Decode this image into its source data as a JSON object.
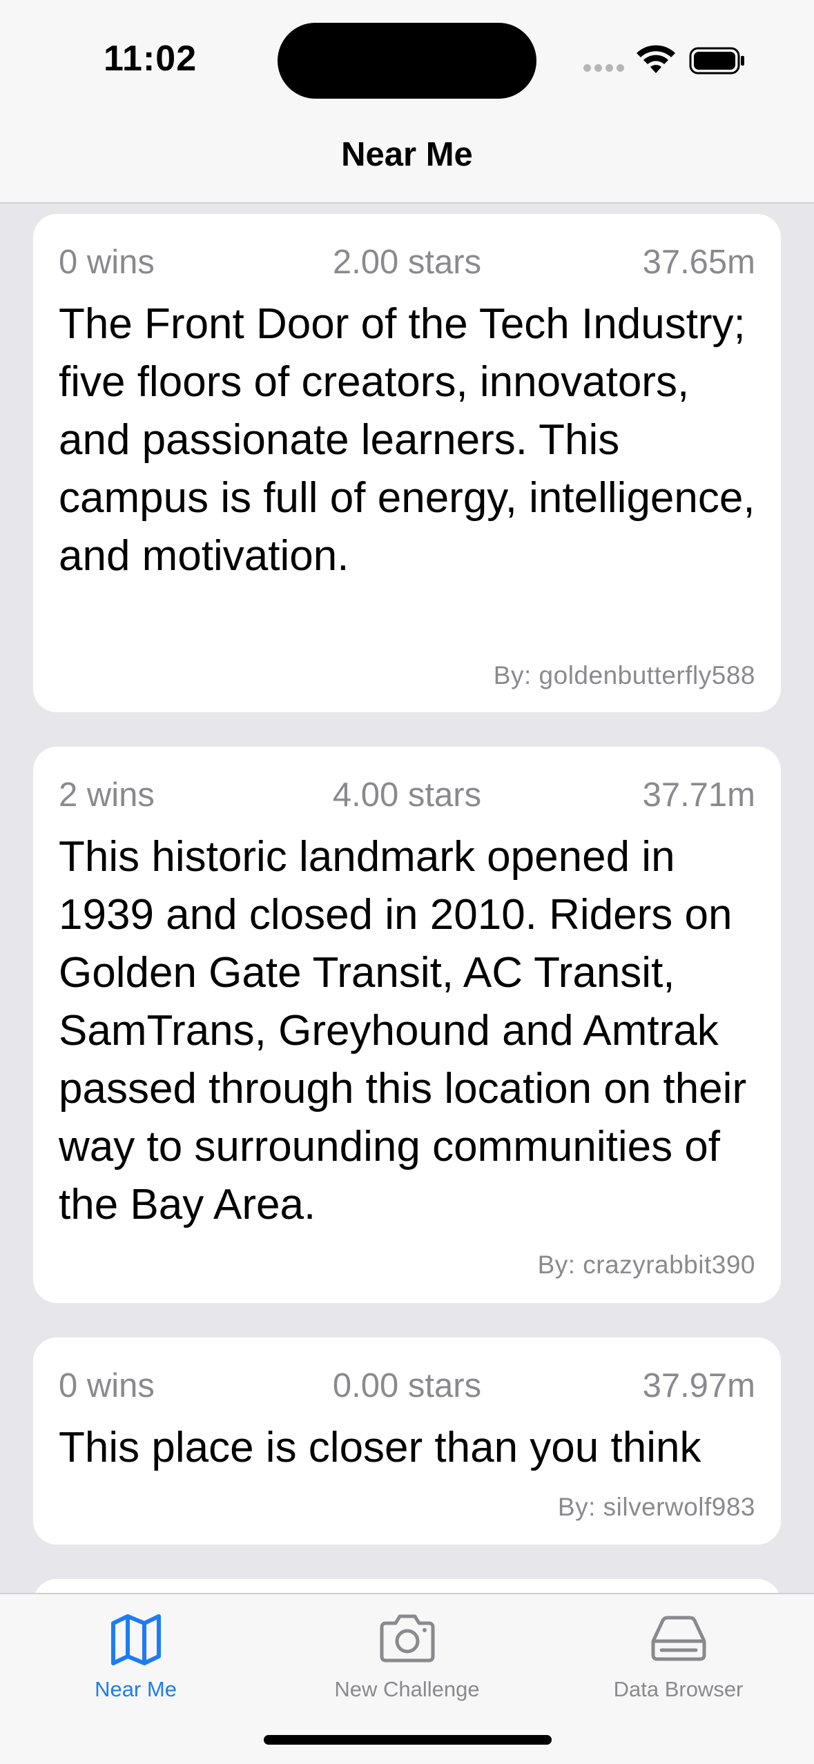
{
  "status_bar": {
    "time": "11:02"
  },
  "nav": {
    "title": "Near Me"
  },
  "challenges": [
    {
      "wins": "0 wins",
      "stars": "2.00 stars",
      "distance": "37.65m",
      "description": "The Front Door of the Tech Industry; five floors of creators, innovators, and passionate learners. This campus is full of energy, intelligence, and motivation.",
      "author": "By: goldenbutterfly588"
    },
    {
      "wins": "2 wins",
      "stars": "4.00 stars",
      "distance": "37.71m",
      "description": "This historic landmark opened in 1939 and closed in 2010. Riders on Golden Gate Transit, AC Transit, SamTrans, Greyhound and Amtrak passed through this location on their way to surrounding communities of the Bay Area.",
      "author": "By: crazyrabbit390"
    },
    {
      "wins": "0 wins",
      "stars": "0.00 stars",
      "distance": "37.97m",
      "description": "This place is closer than you think",
      "author": "By: silverwolf983"
    }
  ],
  "tabs": [
    {
      "label": "Near Me",
      "icon": "map-icon",
      "active": true
    },
    {
      "label": "New Challenge",
      "icon": "camera-icon",
      "active": false
    },
    {
      "label": "Data Browser",
      "icon": "drive-icon",
      "active": false
    }
  ],
  "colors": {
    "accent": "#1d7cf2",
    "secondary_text": "#8a8a8e",
    "background": "#e6e6eb",
    "card": "#ffffff"
  }
}
